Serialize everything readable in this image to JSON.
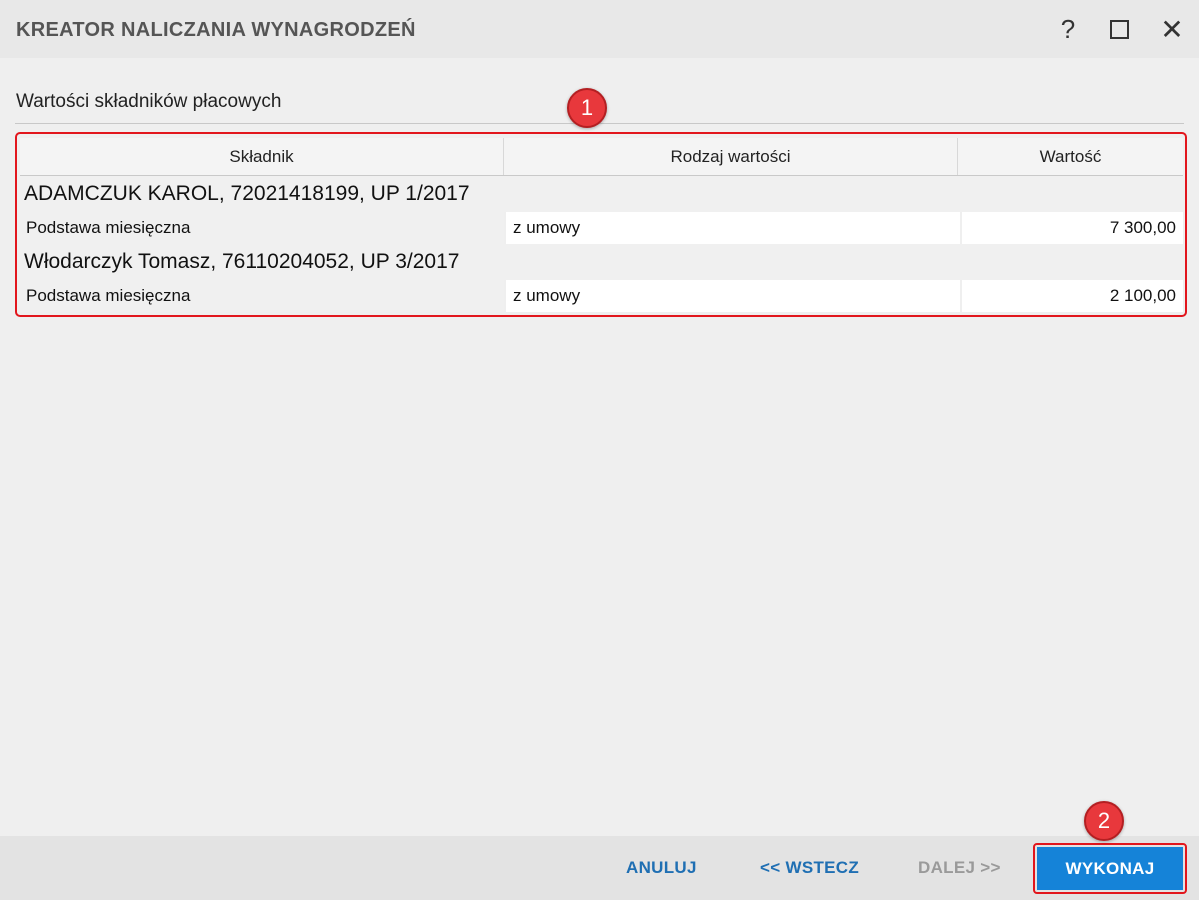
{
  "window": {
    "title": "KREATOR NALICZANIA WYNAGRODZEŃ",
    "help_glyph": "?",
    "close_glyph": "✕"
  },
  "section": {
    "title": "Wartości składników płacowych"
  },
  "badges": [
    "1",
    "2"
  ],
  "grid": {
    "columns": [
      "Składnik",
      "Rodzaj wartości",
      "Wartość"
    ],
    "groups": [
      {
        "header": "ADAMCZUK KAROL, 72021418199, UP 1/2017",
        "rows": [
          {
            "component": "Podstawa miesięczna",
            "value_type": "z umowy",
            "value": "7 300,00"
          }
        ]
      },
      {
        "header": "Włodarczyk Tomasz, 76110204052, UP 3/2017",
        "rows": [
          {
            "component": "Podstawa miesięczna",
            "value_type": "z umowy",
            "value": "2 100,00"
          }
        ]
      }
    ]
  },
  "footer": {
    "cancel_label": "ANULUJ",
    "back_label": "<< WSTECZ",
    "next_label": "DALEJ >>",
    "execute_label": "WYKONAJ"
  },
  "colors": {
    "accent": "#1583d8",
    "link": "#1f6fb3",
    "highlight": "#e2161d"
  }
}
